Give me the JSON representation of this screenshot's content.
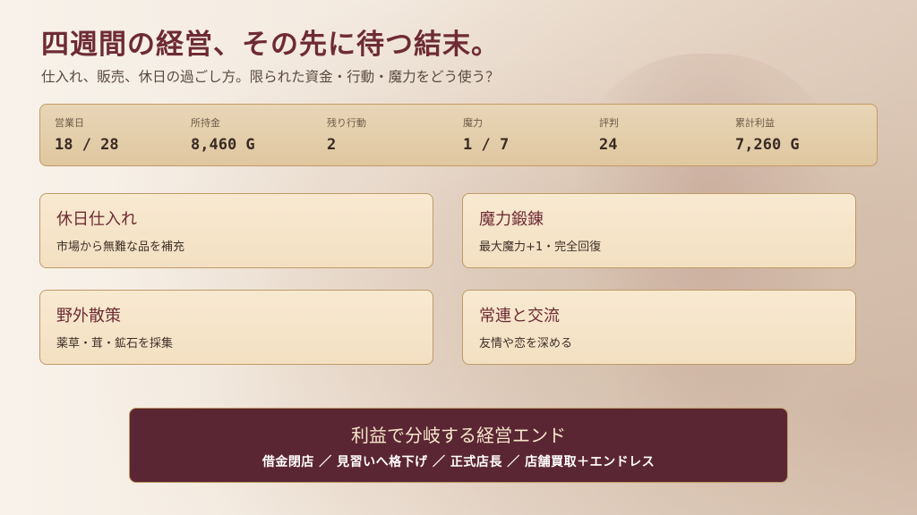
{
  "header": {
    "title": "四週間の経営、その先に待つ結末。",
    "subtitle": "仕入れ、販売、休日の過ごし方。限られた資金・行動・魔力をどう使う？"
  },
  "stats": [
    {
      "label": "営業日",
      "value": "18 / 28"
    },
    {
      "label": "所持金",
      "value": "8,460 G"
    },
    {
      "label": "残り行動",
      "value": "2"
    },
    {
      "label": "魔力",
      "value": "1 / 7"
    },
    {
      "label": "評判",
      "value": "24"
    },
    {
      "label": "累計利益",
      "value": "7,260 G"
    }
  ],
  "actions": [
    {
      "title": "休日仕入れ",
      "desc": "市場から無難な品を補充"
    },
    {
      "title": "魔力鍛錬",
      "desc": "最大魔力+1・完全回復"
    },
    {
      "title": "野外散策",
      "desc": "薬草・茸・鉱石を採集"
    },
    {
      "title": "常連と交流",
      "desc": "友情や恋を深める"
    }
  ],
  "ending": {
    "title": "利益で分岐する経営エンド",
    "list": "借金閉店 ／ 見習いへ格下げ ／ 正式店長 ／ 店舗買取＋エンドレス"
  },
  "colors": {
    "accent": "#6e2b34",
    "panel": "#e5cfaa",
    "card": "#f6e6cc",
    "ending_bg": "#5b2633"
  }
}
